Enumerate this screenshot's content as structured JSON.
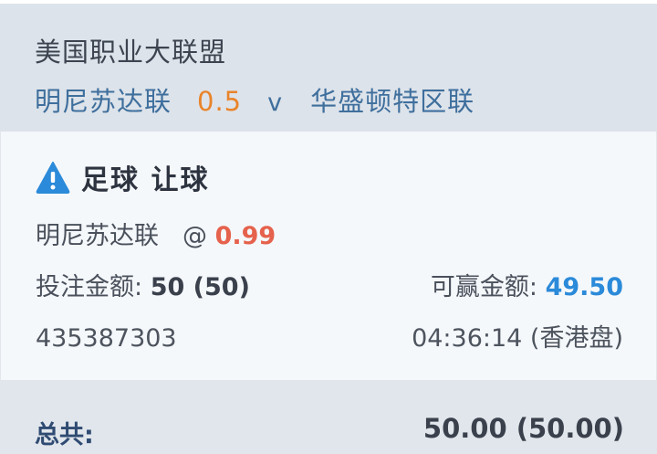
{
  "header": {
    "league": "美国职业大联盟",
    "home_team": "明尼苏达联",
    "handicap": "0.5",
    "vs": "v",
    "away_team": "华盛顿特区联"
  },
  "bet": {
    "warning_icon": "warning-triangle-icon",
    "market": "足球 让球",
    "selection": "明尼苏达联",
    "at": "@",
    "odds": "0.99",
    "stake_label": "投注金额:",
    "stake_value": "50 (50)",
    "win_label": "可赢金额:",
    "win_value": "49.50",
    "ticket_id": "435387303",
    "time": "04:36:14 (香港盘)"
  },
  "footer": {
    "total_label": "总共:",
    "total_value": "50.00 (50.00)"
  },
  "colors": {
    "handicap": "#e9842a",
    "odds": "#e5624c",
    "win": "#2b8ad9",
    "warning": "#2b8ad9"
  }
}
